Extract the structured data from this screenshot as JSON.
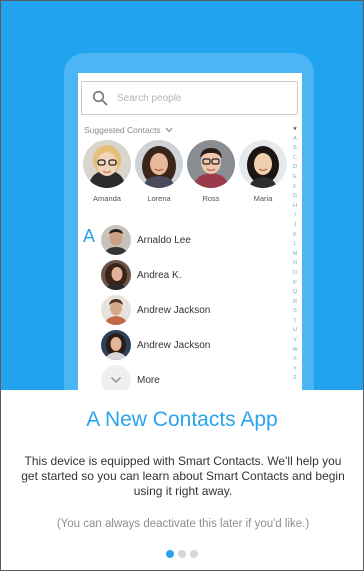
{
  "search": {
    "placeholder": "Search people"
  },
  "suggested": {
    "label": "Suggested Contacts",
    "people": [
      {
        "name": "Amanda"
      },
      {
        "name": "Lorena"
      },
      {
        "name": "Ross"
      },
      {
        "name": "Maria"
      }
    ]
  },
  "index_letters": [
    "★",
    "A",
    "B",
    "C",
    "D",
    "E",
    "F",
    "G",
    "H",
    "I",
    "J",
    "K",
    "L",
    "M",
    "N",
    "O",
    "P",
    "Q",
    "R",
    "S",
    "T",
    "U",
    "V",
    "W",
    "X",
    "Y",
    "Z"
  ],
  "contacts": {
    "section_letter": "A",
    "items": [
      {
        "name": "Arnaldo Lee"
      },
      {
        "name": "Andrea K."
      },
      {
        "name": "Andrew Jackson"
      },
      {
        "name": "Andrew Jackson"
      }
    ],
    "more_label": "More"
  },
  "onboarding": {
    "title": "A New Contacts App",
    "body": "This device is equipped with Smart Contacts. We'll help you get started so you can learn about Smart Contacts and begin using it right away.",
    "note": "(You can always deactivate this later if you'd like.)",
    "page_count": 3,
    "active_page": 1
  },
  "colors": {
    "hero": "#22a3f0",
    "phone": "#4cb5f3",
    "accent": "#29a3ec"
  }
}
